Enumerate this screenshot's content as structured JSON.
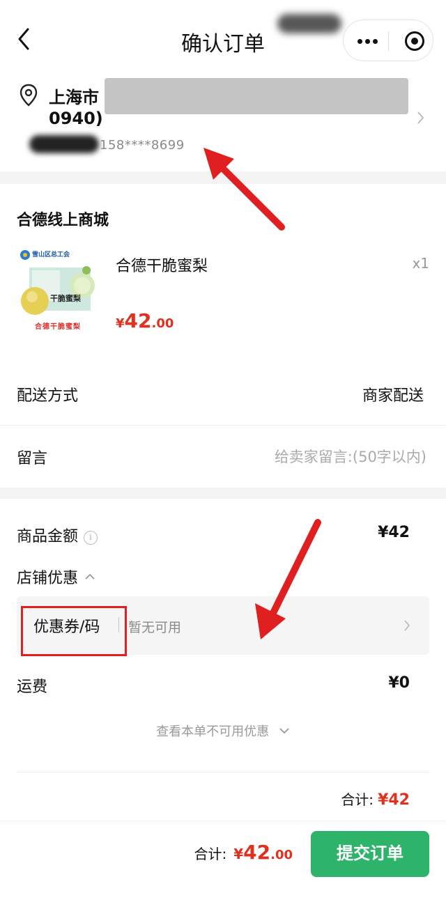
{
  "nav": {
    "title": "确认订单"
  },
  "address": {
    "city": "上海市",
    "code": "0940)",
    "phone": "158****8699"
  },
  "shop": {
    "name": "合德线上商城",
    "product": {
      "title": "合德干脆蜜梨",
      "qty": "x1",
      "price_symbol": "¥",
      "price_int": "42",
      "price_dec": ".00",
      "image_caption": "合德干脆蜜梨",
      "image_header": "雪山区总工会",
      "image_tag": "干脆蜜梨"
    }
  },
  "delivery": {
    "label": "配送方式",
    "value": "商家配送"
  },
  "message": {
    "label": "留言",
    "placeholder": "给卖家留言:(50字以内)"
  },
  "summary": {
    "goods_label": "商品金额",
    "goods_value": "¥42",
    "discount_label": "店铺优惠",
    "coupon_label": "优惠券/码",
    "coupon_status": "暂无可用",
    "freight_label": "运费",
    "freight_value": "¥0",
    "unavailable_text": "查看本单不可用优惠",
    "total_label": "合计:",
    "total_value": "¥42"
  },
  "bottom": {
    "total_label": "合计:",
    "price_symbol": "¥",
    "price_int": "42",
    "price_dec": ".00",
    "submit_label": "提交订单"
  },
  "colors": {
    "accent_red": "#e0301e",
    "submit_green": "#2db36a",
    "annotation_red": "#e02020"
  }
}
